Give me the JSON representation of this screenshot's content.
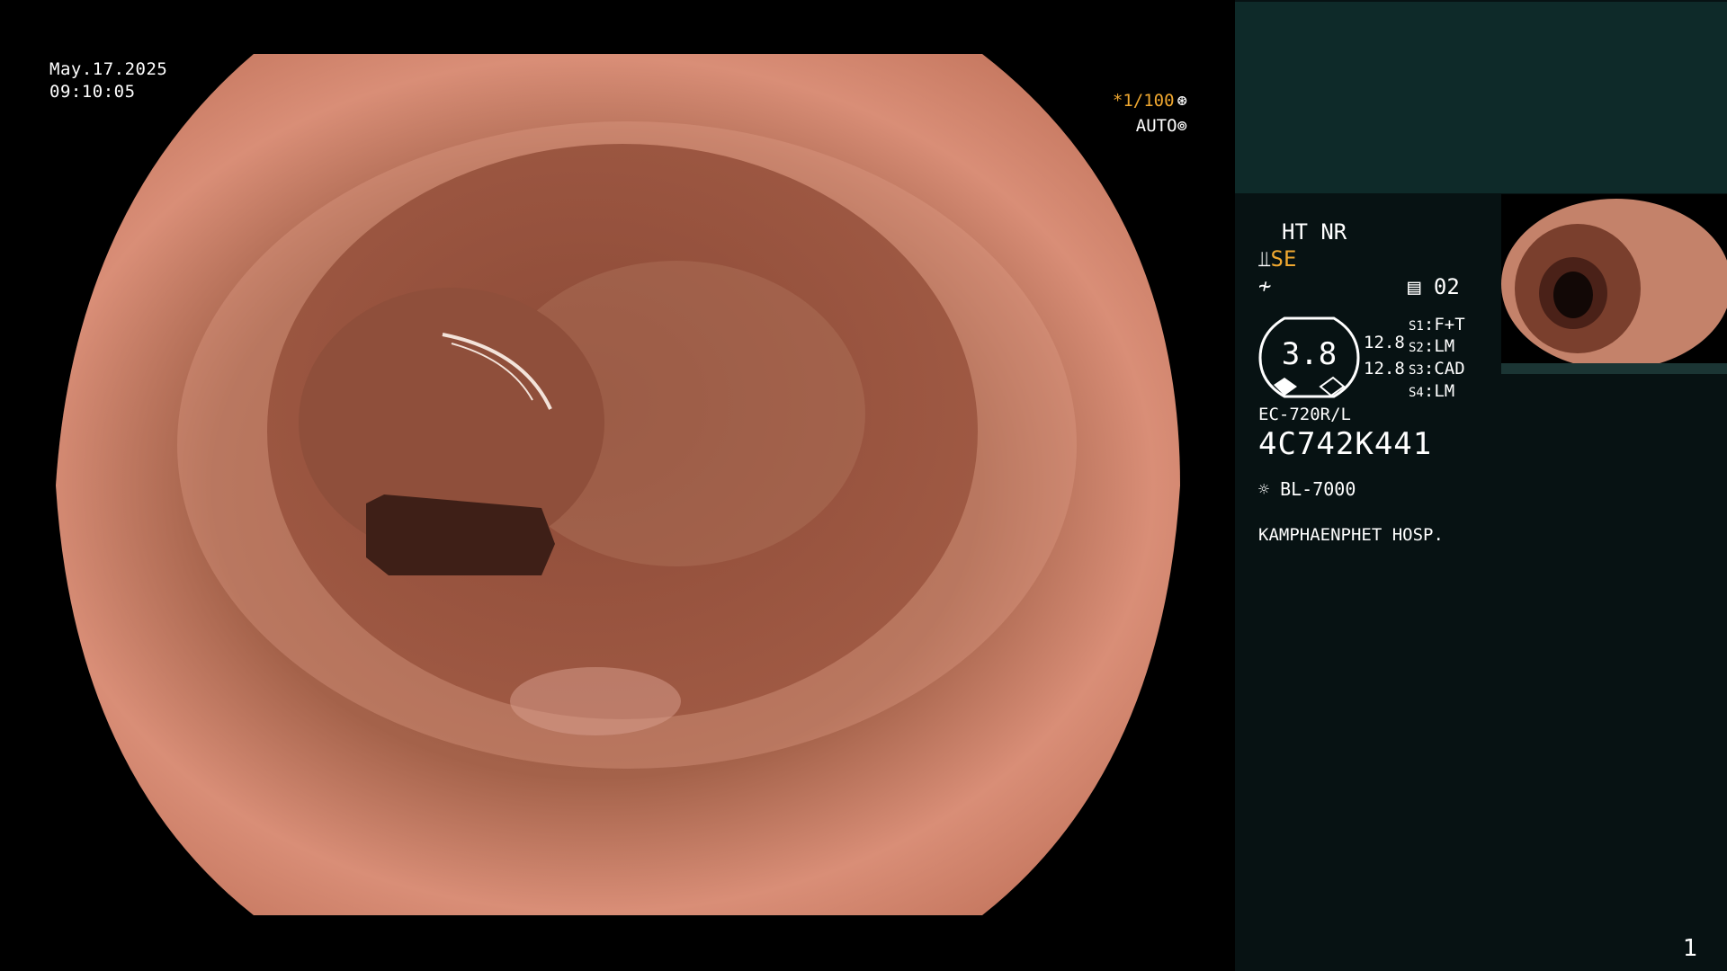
{
  "overlay": {
    "date": "May.17.2025",
    "time": "09:10:05",
    "shutter": "*1/100",
    "shutter_icon": "aperture-icon",
    "iris": "AUTO",
    "iris_icon": "iris-icon"
  },
  "panel": {
    "ht_nr": "HT NR",
    "se": "SE",
    "mem_icon": "memory-icon",
    "mem": "02",
    "gauge_value": "3.8",
    "val1": "12.8",
    "val2": "12.8",
    "s1_key": "S1",
    "s1_val": "F+T",
    "s2_key": "S2",
    "s2_val": "LM",
    "s3_key": "S3",
    "s3_val": "CAD",
    "s4_key": "S4",
    "s4_val": "LM",
    "scope_model": "EC-720R/L",
    "serial": "4C742K441",
    "light_icon": "light-source-icon",
    "light_source": "BL-7000",
    "hospital": "KAMPHAENPHET HOSP."
  },
  "page_number": "1",
  "colors": {
    "accent": "#f0a830",
    "panel_bg": "#071213",
    "panel_top": "#0e2a29"
  }
}
